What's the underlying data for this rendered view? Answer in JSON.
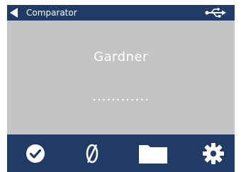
{
  "titlebar": {
    "title": "Comparator",
    "back_icon": "back-arrow-icon",
    "status_icon": "usb-icon"
  },
  "display": {
    "mode": "Gardner",
    "reading": "............"
  },
  "toolbar": {
    "items": [
      {
        "icon": "checkmark-icon"
      },
      {
        "icon": "zero-icon"
      },
      {
        "icon": "folder-icon"
      },
      {
        "icon": "gear-icon"
      }
    ]
  },
  "colors": {
    "bar": "#1f3b66",
    "display": "#c4c4c4",
    "foreground": "#ffffff"
  }
}
